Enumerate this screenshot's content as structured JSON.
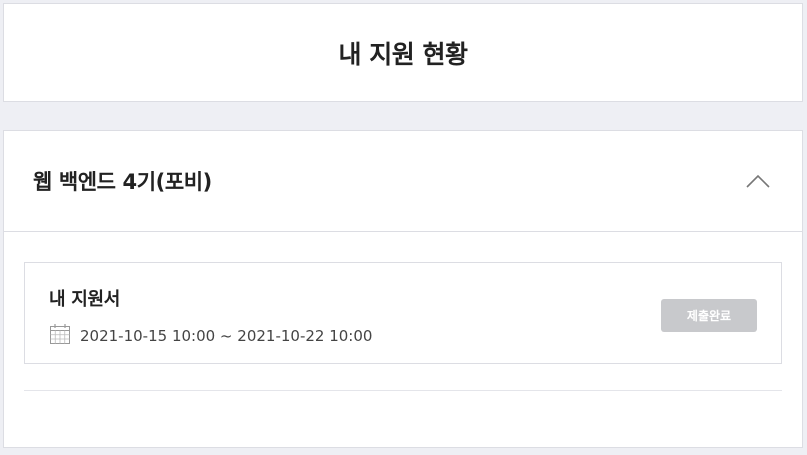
{
  "header": {
    "title": "내 지원 현황"
  },
  "section": {
    "title": "웹 백엔드 4기(포비)",
    "toggle_icon": "chevron-up-icon",
    "application": {
      "title": "내 지원서",
      "period_icon": "calendar-icon",
      "period": "2021-10-15 10:00 ~ 2021-10-22 10:00",
      "status_label": "제출완료"
    }
  },
  "colors": {
    "background": "#eeeff4",
    "status_button": "#c8c9cc",
    "border": "#dcdde3"
  }
}
